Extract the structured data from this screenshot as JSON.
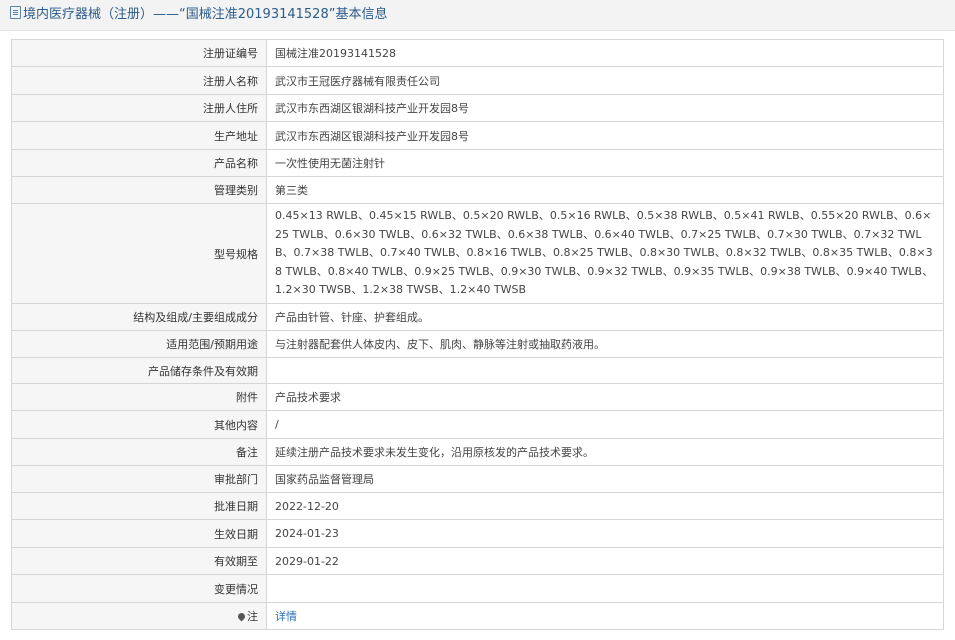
{
  "header": {
    "title": "境内医疗器械（注册）——“国械注准20193141528”基本信息"
  },
  "rows": [
    {
      "label": "注册证编号",
      "value": "国械注准20193141528"
    },
    {
      "label": "注册人名称",
      "value": "武汉市王冠医疗器械有限责任公司"
    },
    {
      "label": "注册人住所",
      "value": "武汉市东西湖区银湖科技产业开发园8号"
    },
    {
      "label": "生产地址",
      "value": "武汉市东西湖区银湖科技产业开发园8号"
    },
    {
      "label": "产品名称",
      "value": "一次性使用无菌注射针"
    },
    {
      "label": "管理类别",
      "value": "第三类"
    },
    {
      "label": "型号规格",
      "value": "0.45×13 RWLB、0.45×15 RWLB、0.5×20 RWLB、0.5×16 RWLB、0.5×38 RWLB、0.5×41 RWLB、0.55×20 RWLB、0.6×25 TWLB、0.6×30 TWLB、0.6×32 TWLB、0.6×38 TWLB、0.6×40 TWLB、0.7×25 TWLB、0.7×30 TWLB、0.7×32 TWLB、0.7×38 TWLB、0.7×40 TWLB、0.8×16 TWLB、0.8×25 TWLB、0.8×30 TWLB、0.8×32 TWLB、0.8×35 TWLB、0.8×38 TWLB、0.8×40 TWLB、0.9×25 TWLB、0.9×30 TWLB、0.9×32 TWLB、0.9×35 TWLB、0.9×38 TWLB、0.9×40 TWLB、1.2×30 TWSB、1.2×38 TWSB、1.2×40 TWSB"
    },
    {
      "label": "结构及组成/主要组成成分",
      "value": "产品由针管、针座、护套组成。"
    },
    {
      "label": "适用范围/预期用途",
      "value": "与注射器配套供人体皮内、皮下、肌肉、静脉等注射或抽取药液用。"
    },
    {
      "label": "产品储存条件及有效期",
      "value": ""
    },
    {
      "label": "附件",
      "value": "产品技术要求"
    },
    {
      "label": "其他内容",
      "value": "/"
    },
    {
      "label": "备注",
      "value": "延续注册产品技术要求未发生变化，沿用原核发的产品技术要求。"
    },
    {
      "label": "审批部门",
      "value": "国家药品监督管理局"
    },
    {
      "label": "批准日期",
      "value": "2022-12-20"
    },
    {
      "label": "生效日期",
      "value": "2024-01-23"
    },
    {
      "label": "有效期至",
      "value": "2029-01-22"
    },
    {
      "label": "变更情况",
      "value": ""
    },
    {
      "label": "注",
      "value": "详情"
    }
  ]
}
